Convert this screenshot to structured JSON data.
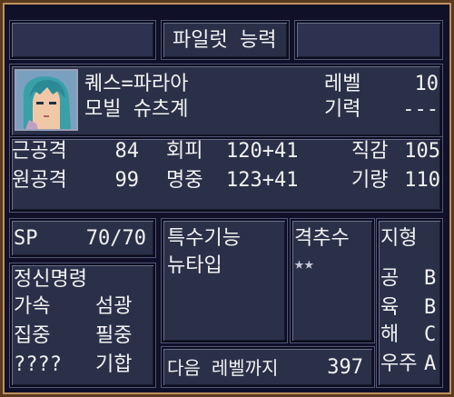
{
  "header": {
    "title": "파일럿 능력"
  },
  "pilot": {
    "name": "퀘스=파라아",
    "unit": "모빌 슈츠계",
    "level_label": "레벨",
    "level_value": "10",
    "spirit_label": "기력",
    "spirit_value": "---"
  },
  "stats": {
    "row1": [
      {
        "label": "근공격",
        "value": "84"
      },
      {
        "label": "회피",
        "value": "120+41"
      },
      {
        "label": "직감",
        "value": "105"
      }
    ],
    "row2": [
      {
        "label": "원공격",
        "value": "99"
      },
      {
        "label": "명중",
        "value": "123+41"
      },
      {
        "label": "기량",
        "value": "110"
      }
    ]
  },
  "sp": {
    "label": "SP",
    "value": "70/70"
  },
  "spirit_commands": {
    "title": "정신명령",
    "items": [
      "가속",
      "섬광",
      "집중",
      "필중",
      "????",
      "기합"
    ]
  },
  "special_skills": {
    "title": "특수기능",
    "items": [
      "뉴타입"
    ]
  },
  "follow_up": {
    "title": "격추수",
    "stars": "★★"
  },
  "terrain": {
    "title": "지형",
    "rows": [
      {
        "label": "공",
        "rank": "B"
      },
      {
        "label": "육",
        "rank": "B"
      },
      {
        "label": "해",
        "rank": "C"
      },
      {
        "label": "우주",
        "rank": "A"
      }
    ]
  },
  "next_level": {
    "label": "다음 레벨까지",
    "value": "397"
  },
  "colors": {
    "panel": "#2a3048",
    "frame_border": "#c09060",
    "text": "#f2f2f2"
  }
}
